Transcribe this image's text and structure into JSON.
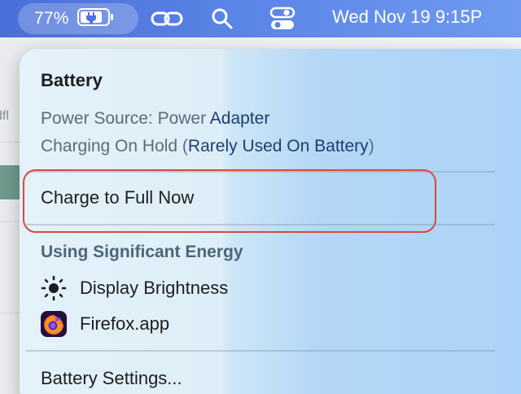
{
  "menubar": {
    "battery_percent": "77%",
    "clock": "Wed Nov 19  9:15P",
    "icons": [
      "battery-charging-icon",
      "link-icon",
      "search-icon",
      "control-center-icon"
    ]
  },
  "background": {
    "tab_fragment": "dfl"
  },
  "popover": {
    "title": "Battery",
    "power_source_prefix": "Power Source: Power ",
    "power_source_value": "Adapter",
    "charging_prefix": "Charging On Hold (",
    "charging_value": "Rarely Used On Battery",
    "charging_suffix": ")",
    "charge_action": "Charge to Full Now",
    "section_heading": "Using Significant Energy",
    "apps": [
      {
        "label": "Display Brightness",
        "icon": "sun-icon"
      },
      {
        "label": "Firefox.app",
        "icon": "firefox-icon"
      }
    ],
    "settings_item": "Battery Settings..."
  },
  "colors": {
    "menubar_blue": "#5a84e6",
    "highlight_red": "#d9493c",
    "accent_text": "#1f3e70"
  }
}
